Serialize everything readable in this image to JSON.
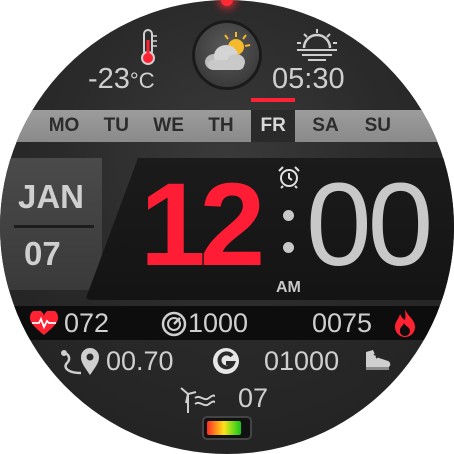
{
  "weather": {
    "temperature": "-23",
    "unit": "°C",
    "sunset_time": "05:30"
  },
  "days": [
    "MO",
    "TU",
    "WE",
    "TH",
    "FR",
    "SA",
    "SU"
  ],
  "active_day": "FR",
  "date": {
    "month": "JAN",
    "day": "07"
  },
  "time": {
    "hour": "12",
    "minute": "00",
    "ampm": "AM"
  },
  "stats": {
    "heart_rate": "072",
    "steps_goal": "1000",
    "calories": "0075",
    "distance": "00.70",
    "steps": "01000",
    "wind": "07"
  },
  "battery": {
    "level": 0.85
  },
  "colors": {
    "accent": "#ff1d35",
    "text": "#cfcfcf"
  }
}
